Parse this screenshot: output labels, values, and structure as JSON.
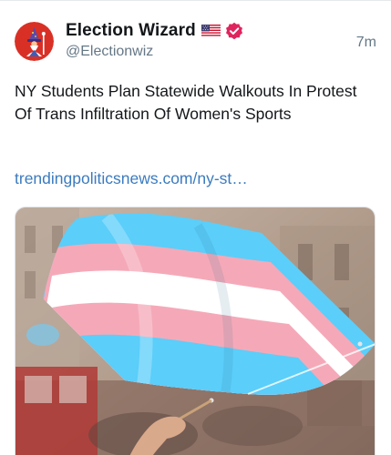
{
  "post": {
    "author": {
      "display_name": "Election Wizard",
      "handle": "@Electionwiz",
      "flag_icon": "us-flag-icon",
      "verified_icon": "verified-badge-icon",
      "verified_color": "#e0245e",
      "avatar_color": "#d93025"
    },
    "timestamp": "7m",
    "text": "NY Students Plan Statewide Walkouts In Protest Of Trans Infiltration Of Women's Sports",
    "link_text": "trendingpoliticsnews.com/ny-st…",
    "link_color": "#3b7bbf",
    "media": {
      "flag_colors": [
        "#5bcefa",
        "#f5a9b8",
        "#ffffff"
      ]
    }
  }
}
